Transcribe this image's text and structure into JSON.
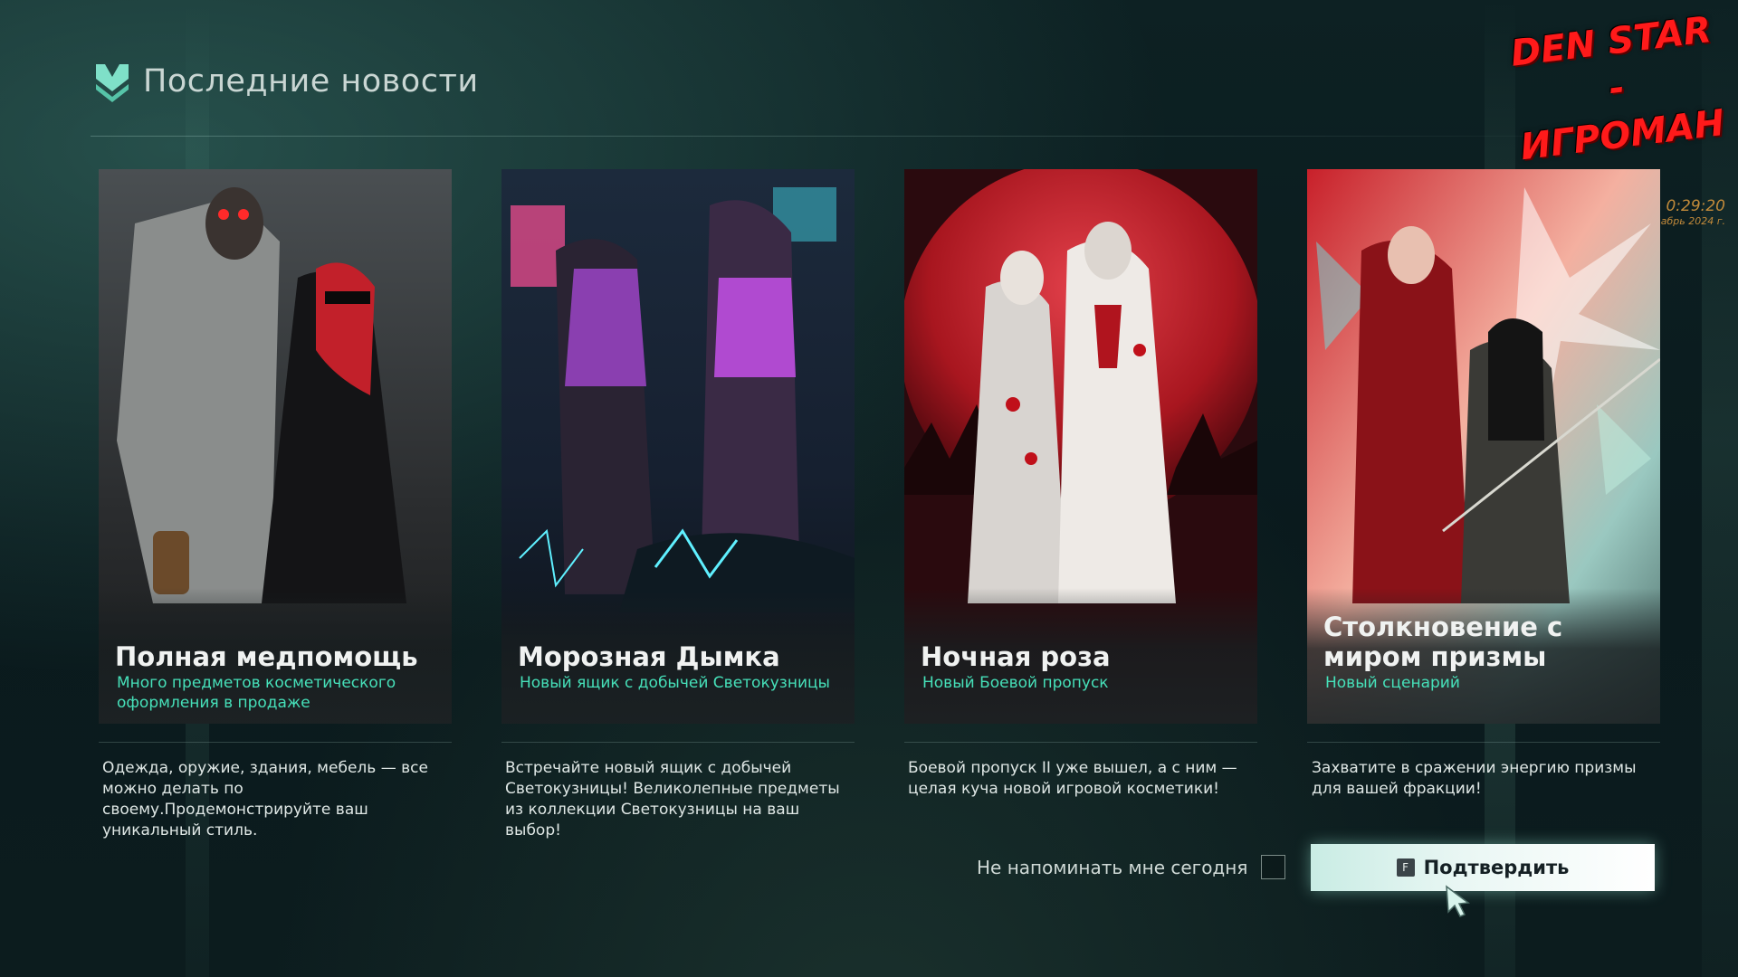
{
  "header": {
    "title": "Последние новости",
    "logo_icon": "brand-logo-icon"
  },
  "watermark": {
    "line1": "DEN STAR -",
    "line2": "ИГРОМАН"
  },
  "clock": {
    "time": "0:29:20",
    "date": "абрь 2024 г."
  },
  "cards": [
    {
      "title": "Полная медпомощь",
      "subtitle": "Много предметов косметического оформления в продаже",
      "description": "Одежда, оружие, здания, мебель — все можно делать по своему.Продемонстрируйте ваш уникальный стиль.",
      "accent": "#46e0b9"
    },
    {
      "title": "Морозная Дымка",
      "subtitle": "Новый ящик с добычей Светокузницы",
      "description": "Встречайте новый ящик с добычей Светокузницы! Великолепные предметы из коллекции Светокузницы на ваш выбор!",
      "accent": "#46e0b9"
    },
    {
      "title": "Ночная роза",
      "subtitle": "Новый Боевой пропуск",
      "description": "Боевой пропуск II уже вышел, а с ним — целая куча новой игровой косметики!",
      "accent": "#46e0b9"
    },
    {
      "title": "Столкновение с миром призмы",
      "subtitle": "Новый сценарий",
      "description": "Захватите в сражении энергию призмы для вашей фракции!",
      "accent": "#46e0b9"
    }
  ],
  "footer": {
    "remind_label": "Не напоминать мне сегодня",
    "remind_checked": false,
    "confirm_key": "F",
    "confirm_label": "Подтвердить"
  }
}
